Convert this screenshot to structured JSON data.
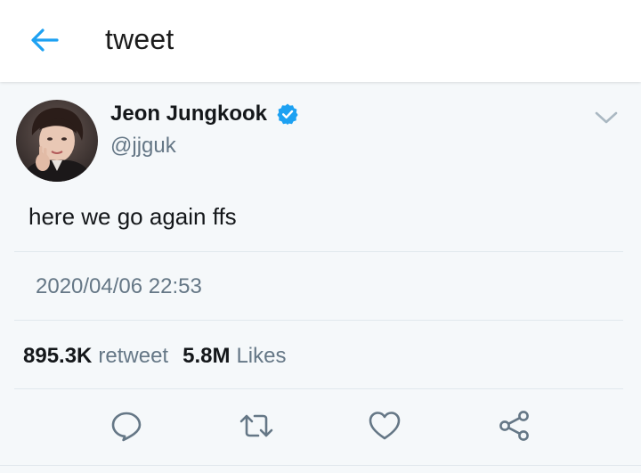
{
  "appbar": {
    "title": "tweet",
    "back_icon": "arrow-left-icon",
    "accent": "#1da1f2"
  },
  "tweet": {
    "author": {
      "display_name": "Jeon Jungkook",
      "handle": "@jjguk",
      "verified": true,
      "verified_color": "#1da1f2"
    },
    "text": "here we go again ffs",
    "timestamp": "2020/04/06 22:53",
    "stats": {
      "retweets_count": "895.3K",
      "retweets_label": "retweet",
      "likes_count": "5.8M",
      "likes_label": "Likes"
    },
    "actions": [
      {
        "icon": "reply-icon"
      },
      {
        "icon": "retweet-icon"
      },
      {
        "icon": "like-icon"
      },
      {
        "icon": "share-icon"
      }
    ]
  }
}
